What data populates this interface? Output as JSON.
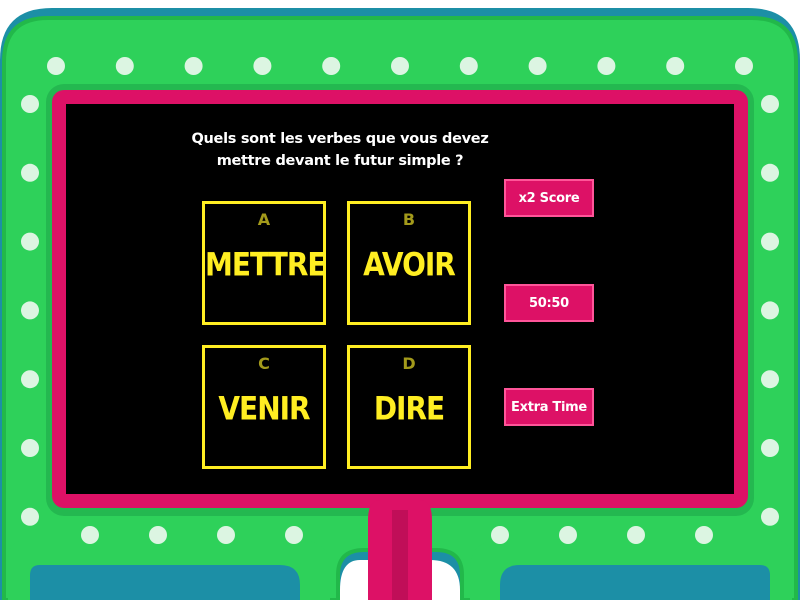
{
  "question": "Quels sont les verbes que vous devez mettre devant le futur simple ?",
  "answers": [
    {
      "letter": "A",
      "text": "METTRE"
    },
    {
      "letter": "B",
      "text": "AVOIR"
    },
    {
      "letter": "C",
      "text": "VENIR"
    },
    {
      "letter": "D",
      "text": "DIRE"
    }
  ],
  "powerups": [
    "x2 Score",
    "50:50",
    "Extra Time"
  ],
  "colors": {
    "outer_frame": "#1c8fa6",
    "green_frame": "#2ed15a",
    "inner_ring": "#dd1166",
    "answer_accent": "#ffee22",
    "powerup_bg": "#dd1166"
  }
}
